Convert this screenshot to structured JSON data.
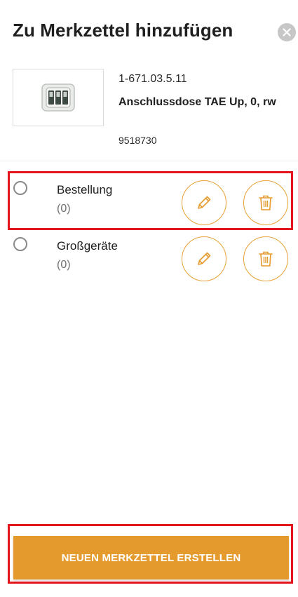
{
  "header": {
    "title": "Zu Merkzettel hinzufügen",
    "close_icon": "close-icon"
  },
  "product": {
    "image_icon": "tae-socket-image",
    "number": "1-671.03.5.11",
    "name": "Anschlussdose TAE Up, 0, rw",
    "article": "9518730"
  },
  "lists": [
    {
      "name": "Bestellung",
      "count": "(0)",
      "selected": false,
      "edit_icon": "pencil-icon",
      "delete_icon": "trash-icon"
    },
    {
      "name": "Großgeräte",
      "count": "(0)",
      "selected": false,
      "edit_icon": "pencil-icon",
      "delete_icon": "trash-icon"
    }
  ],
  "footer": {
    "create_button_label": "NEUEN MERKZETTEL ERSTELLEN"
  },
  "colors": {
    "accent": "#e59a2e",
    "highlight": "#e3141b",
    "close_bg": "#c7c7c7"
  }
}
